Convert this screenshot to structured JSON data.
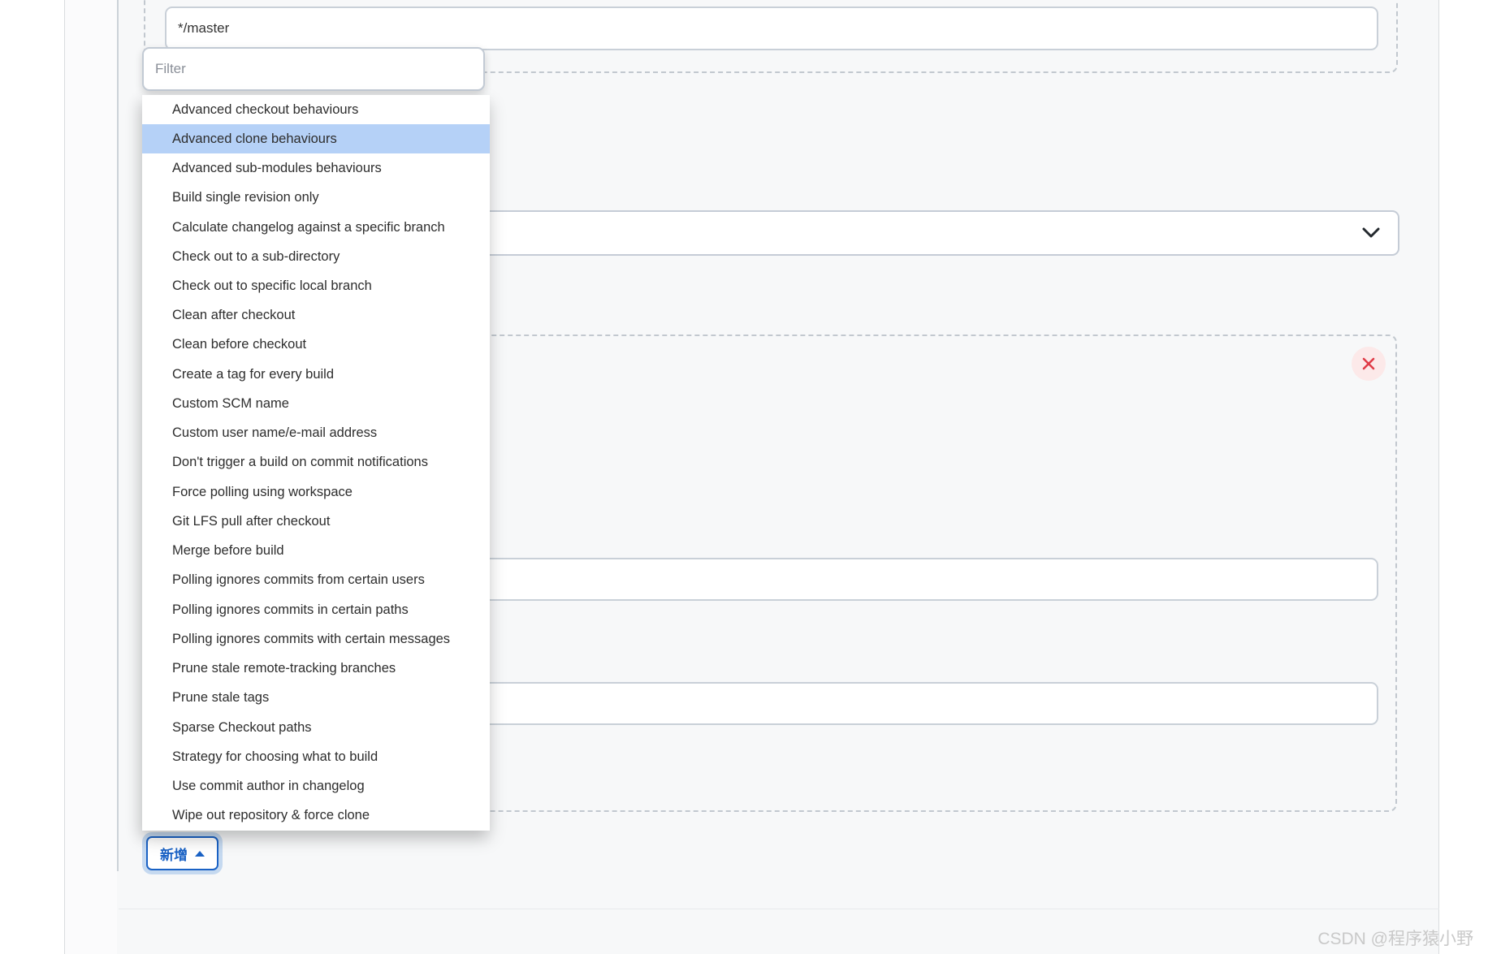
{
  "colors": {
    "accent": "#1a62c5",
    "highlight": "#b5d1f7",
    "danger": "#e03b47",
    "danger_bg": "#fce9e9"
  },
  "branch_field": {
    "value": "*/master"
  },
  "filter_field": {
    "placeholder": "Filter"
  },
  "behaviours_menu": {
    "selected_index": 1,
    "items": [
      "Advanced checkout behaviours",
      "Advanced clone behaviours",
      "Advanced sub-modules behaviours",
      "Build single revision only",
      "Calculate changelog against a specific branch",
      "Check out to a sub-directory",
      "Check out to specific local branch",
      "Clean after checkout",
      "Clean before checkout",
      "Create a tag for every build",
      "Custom SCM name",
      "Custom user name/e-mail address",
      "Don't trigger a build on commit notifications",
      "Force polling using workspace",
      "Git LFS pull after checkout",
      "Merge before build",
      "Polling ignores commits from certain users",
      "Polling ignores commits in certain paths",
      "Polling ignores commits with certain messages",
      "Prune stale remote-tracking branches",
      "Prune stale tags",
      "Sparse Checkout paths",
      "Strategy for choosing what to build",
      "Use commit author in changelog",
      "Wipe out repository & force clone"
    ]
  },
  "repository_browser": {
    "value": ""
  },
  "behaviour_inputs": {
    "input_a": "",
    "input_b": ""
  },
  "add_button": {
    "label": "新增"
  },
  "watermark": "CSDN @程序猿小野"
}
